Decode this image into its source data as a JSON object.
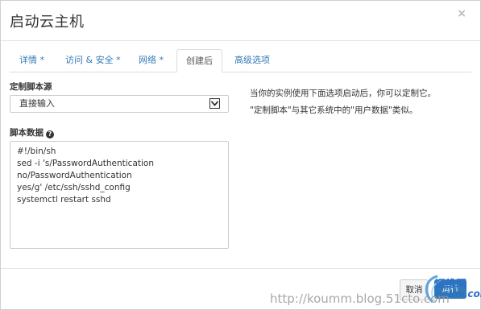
{
  "dialog": {
    "title": "启动云主机",
    "close_glyph": "×"
  },
  "tabs": [
    {
      "label": "详情 *",
      "active": false
    },
    {
      "label": "访问 & 安全 *",
      "active": false
    },
    {
      "label": "网络 *",
      "active": false
    },
    {
      "label": "创建后",
      "active": true
    },
    {
      "label": "高级选项",
      "active": false
    }
  ],
  "form": {
    "source_label": "定制脚本源",
    "source_selected": "直接输入",
    "data_label": "脚本数据",
    "data_help_icon": "question-circle-icon",
    "script_content": "#!/bin/sh\nsed -i 's/PasswordAuthentication\nno/PasswordAuthentication\nyes/g' /etc/ssh/sshd_config\nsystemctl restart sshd"
  },
  "help": {
    "line1": "当你的实例使用下面选项启动后，你可以定制它。",
    "line2": "\"定制脚本\"与其它系统中的\"用户数据\"类似。"
  },
  "footer": {
    "cancel_label": "取消",
    "launch_label": "运行"
  },
  "watermark": {
    "url": "http://koumm.blog.51cto.com",
    "logo_cn": "运维网",
    "logo_en": "iyunv.com"
  },
  "colors": {
    "link": "#337ab7",
    "primary": "#337ab7",
    "border": "#cccccc"
  }
}
